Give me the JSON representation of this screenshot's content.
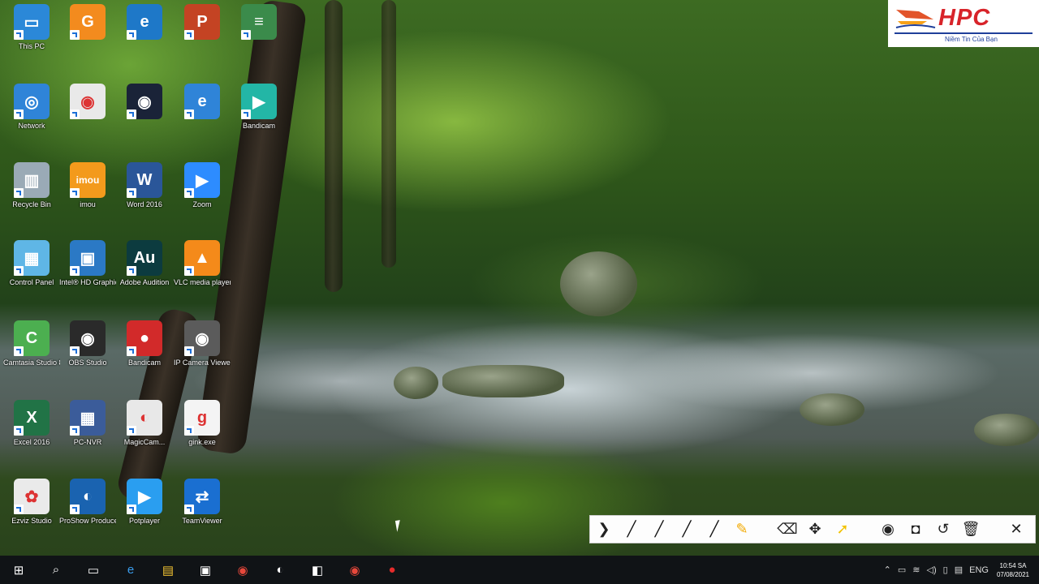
{
  "logo": {
    "text": "HPC",
    "slogan": "Niềm Tin Của Bạn"
  },
  "desktop_icons": [
    {
      "id": "this-pc",
      "label": "This PC",
      "color": "#2b88d8",
      "glyph": "▭"
    },
    {
      "id": "gmail-shortcut",
      "label": "",
      "color": "#f38b1e",
      "glyph": "G"
    },
    {
      "id": "edge",
      "label": "",
      "color": "#1e78c8",
      "glyph": "e"
    },
    {
      "id": "powerpoint",
      "label": "",
      "color": "#c44323",
      "glyph": "P"
    },
    {
      "id": "document",
      "label": "",
      "color": "#3b8b4b",
      "glyph": "≡"
    },
    {
      "id": "network",
      "label": "Network",
      "color": "#2f84d8",
      "glyph": "◎"
    },
    {
      "id": "chrome",
      "label": "",
      "color": "#e9e9e9",
      "glyph": "◉"
    },
    {
      "id": "app-camera",
      "label": "",
      "color": "#1a2338",
      "glyph": "◉"
    },
    {
      "id": "zalo",
      "label": "",
      "color": "#2f84d8",
      "glyph": "e"
    },
    {
      "id": "bandicam-mp3",
      "label": "Bandicam",
      "color": "#23b6a6",
      "glyph": "▶"
    },
    {
      "id": "recycle-bin",
      "label": "Recycle Bin",
      "color": "#9aaab6",
      "glyph": "▥"
    },
    {
      "id": "imou",
      "label": "imou",
      "color": "#f39a1c",
      "glyph": "imou"
    },
    {
      "id": "word",
      "label": "Word 2016",
      "color": "#2a5699",
      "glyph": "W"
    },
    {
      "id": "zoom",
      "label": "Zoom",
      "color": "#2d8cff",
      "glyph": "▶"
    },
    {
      "id": "control-panel",
      "label": "Control Panel",
      "color": "#5fb6e6",
      "glyph": "▦"
    },
    {
      "id": "intel-hd",
      "label": "Intel® HD Graphic...",
      "color": "#2b79c5",
      "glyph": "▣"
    },
    {
      "id": "audition",
      "label": "Adobe Audition",
      "color": "#0c3b3f",
      "glyph": "Au"
    },
    {
      "id": "vlc",
      "label": "VLC media player",
      "color": "#f48a1a",
      "glyph": "▲"
    },
    {
      "id": "camtasia",
      "label": "Camtasia Studio 8",
      "color": "#4caf50",
      "glyph": "C"
    },
    {
      "id": "obs",
      "label": "OBS Studio",
      "color": "#2a2a2a",
      "glyph": "◉"
    },
    {
      "id": "bandicam",
      "label": "Bandicam",
      "color": "#d22a2a",
      "glyph": "●"
    },
    {
      "id": "ip-camera",
      "label": "IP Camera Viewer",
      "color": "#5b5b5b",
      "glyph": "◉"
    },
    {
      "id": "excel",
      "label": "Excel 2016",
      "color": "#217346",
      "glyph": "X"
    },
    {
      "id": "pc-nvr",
      "label": "PC-NVR",
      "color": "#3b5c9a",
      "glyph": "▦"
    },
    {
      "id": "magicam",
      "label": "MagicCam...",
      "color": "#e8e8e8",
      "glyph": "◐"
    },
    {
      "id": "gink",
      "label": "gink.exe",
      "color": "#f4f4f4",
      "glyph": "g"
    },
    {
      "id": "ezviz",
      "label": "Ezviz Studio",
      "color": "#eaeaea",
      "glyph": "✿"
    },
    {
      "id": "proshow",
      "label": "ProShow Producer",
      "color": "#1a63b0",
      "glyph": "◐"
    },
    {
      "id": "potplayer",
      "label": "Potplayer",
      "color": "#2a9ef0",
      "glyph": "▶"
    },
    {
      "id": "teamviewer",
      "label": "TeamViewer",
      "color": "#1a6fd1",
      "glyph": "⇄"
    }
  ],
  "drawbar": {
    "tools": [
      "collapse",
      "pen-1",
      "pen-2",
      "pen-3",
      "pen-4",
      "highlighter",
      "eraser",
      "move",
      "pointer",
      "eye",
      "camera",
      "undo",
      "trash",
      "close"
    ],
    "glyphs": [
      "❯",
      "╱",
      "╱",
      "╱",
      "╱",
      "✎",
      "⌫",
      "✥",
      "➚",
      "◉",
      "◘",
      "↺",
      "🗑",
      "✕"
    ]
  },
  "taskbar": {
    "buttons": [
      "start",
      "search",
      "task-view",
      "edge",
      "file-explorer",
      "store",
      "chrome",
      "app",
      "app2",
      "chrome-2",
      "record"
    ],
    "glyphs": [
      "⊞",
      "⌕",
      "▭",
      "e",
      "▤",
      "▣",
      "◉",
      "◐",
      "◧",
      "◉",
      "●"
    ],
    "tray": {
      "language": "ENG",
      "time": "10:54 SA",
      "date": "07/08/2021"
    }
  }
}
